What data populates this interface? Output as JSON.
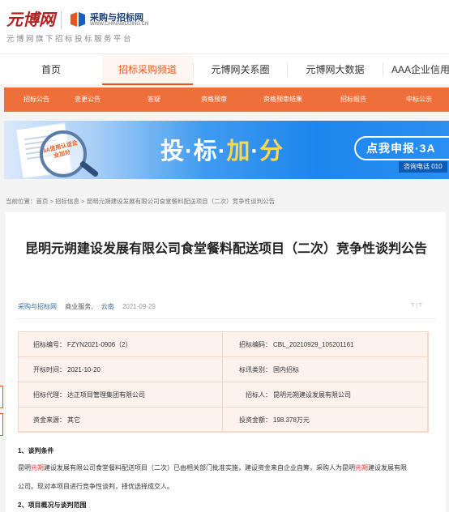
{
  "header": {
    "logo_text": "元博网",
    "partner_title": "采购与招标网",
    "partner_url": "WWW.CHINABIDDING.CN",
    "subtitle": "元博网旗下招标投标服务平台"
  },
  "nav": {
    "items": [
      {
        "label": "首页"
      },
      {
        "label": "招标采购频道"
      },
      {
        "label": "元博网关系圈"
      },
      {
        "label": "元博网大数据"
      },
      {
        "label": "AAA企业信用"
      }
    ]
  },
  "subnav": {
    "items": [
      {
        "label": "招标公告"
      },
      {
        "label": "变更公告"
      },
      {
        "label": "答疑"
      },
      {
        "label": "资格预审"
      },
      {
        "label": "资格预审结果"
      },
      {
        "label": "招标报告"
      },
      {
        "label": "中标公示"
      }
    ]
  },
  "banner": {
    "stamp_text": "3A信用认证企业加分",
    "slogan_1": "投",
    "slogan_2": "标",
    "slogan_3": "加",
    "slogan_4": "分",
    "cta": "点我申报·3A",
    "phone": "咨询电话 010"
  },
  "breadcrumb": "当前位置：首页 > 招标信息 > 昆明元朔建设发展有限公司食堂餐料配送项目（二次）竞争性谈判公告",
  "article": {
    "title": "昆明元朔建设发展有限公司食堂餐料配送项目（二次）竞争性谈判公告",
    "source": "采购与招标网",
    "category": "商业服务,",
    "region": "云南",
    "date": "2021-09-29",
    "font_toggle": "T | T",
    "info": {
      "bid_no_label": "招标编号：",
      "bid_no": "FZYN2021-0906（2）",
      "bid_code_label": "招标编码：",
      "bid_code": "CBL_20210929_105201161",
      "open_time_label": "开标时间：",
      "open_time": "2021-10-20",
      "bid_type_label": "标讯类别：",
      "bid_type": "国内招标",
      "agent_label": "招标代理：",
      "agent": "达正项目管理集团有限公司",
      "tenderer_label": "招标人：",
      "tenderer": "昆明元朔建设发展有限公司",
      "fund_label": "资金来源：",
      "fund": "其它",
      "amount_label": "投资金额：",
      "amount": "198.378万元"
    },
    "section1_title": "1、谈判条件",
    "para1_a": "昆明",
    "para1_b": "元朔",
    "para1_c": "建设发展有限公司食堂餐料配送项目（二次）已由相关部门批准实施，建设资金来自企业自筹，采购人为昆明",
    "para1_d": "元朔",
    "para1_e": "建设发展有限",
    "para1_line2": "公司。现对本项目进行竞争性谈判，择优选择成交人。",
    "section2_title": "2、项目概况与谈判范围"
  }
}
